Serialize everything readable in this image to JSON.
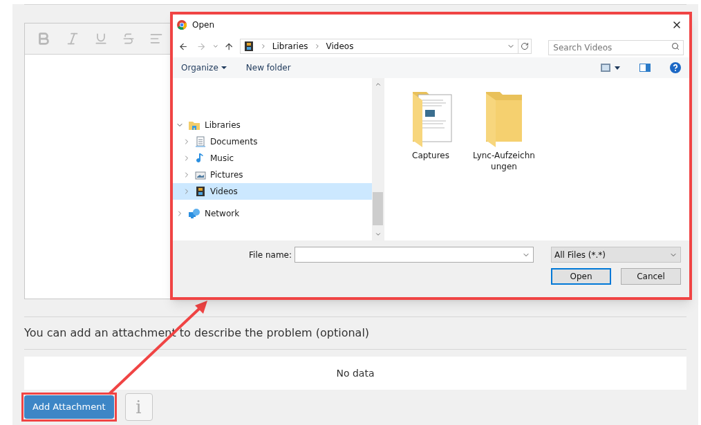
{
  "page": {
    "attachment_hint": "You can add an attachment to describe the problem (optional)",
    "empty_table": "No data",
    "add_button": "Add Attachment",
    "info_button": "i"
  },
  "dialog": {
    "title": "Open",
    "breadcrumb": [
      "Libraries",
      "Videos"
    ],
    "search": {
      "placeholder": "Search Videos"
    },
    "toolbar": [
      "Organize",
      "New folder"
    ],
    "tree": [
      {
        "label": "Libraries",
        "kind": "library",
        "expanded": true,
        "selected": false,
        "children": [
          {
            "label": "Documents",
            "kind": "documents",
            "expanded": false,
            "selected": false
          },
          {
            "label": "Music",
            "kind": "music",
            "expanded": false,
            "selected": false
          },
          {
            "label": "Pictures",
            "kind": "pictures",
            "expanded": false,
            "selected": false
          },
          {
            "label": "Videos",
            "kind": "videos",
            "expanded": false,
            "selected": true
          }
        ]
      },
      {
        "label": "Network",
        "kind": "network",
        "expanded": false,
        "selected": false
      }
    ],
    "items": [
      {
        "label": "Captures",
        "kind": "preview"
      },
      {
        "label": "Lync-Aufzeichnungen",
        "kind": "plain"
      }
    ],
    "file_name": {
      "label": "File name:"
    },
    "file_type": "All Files (*.*)",
    "buttons": [
      {
        "label": "Open",
        "default": true
      },
      {
        "label": "Cancel",
        "default": false
      }
    ]
  }
}
